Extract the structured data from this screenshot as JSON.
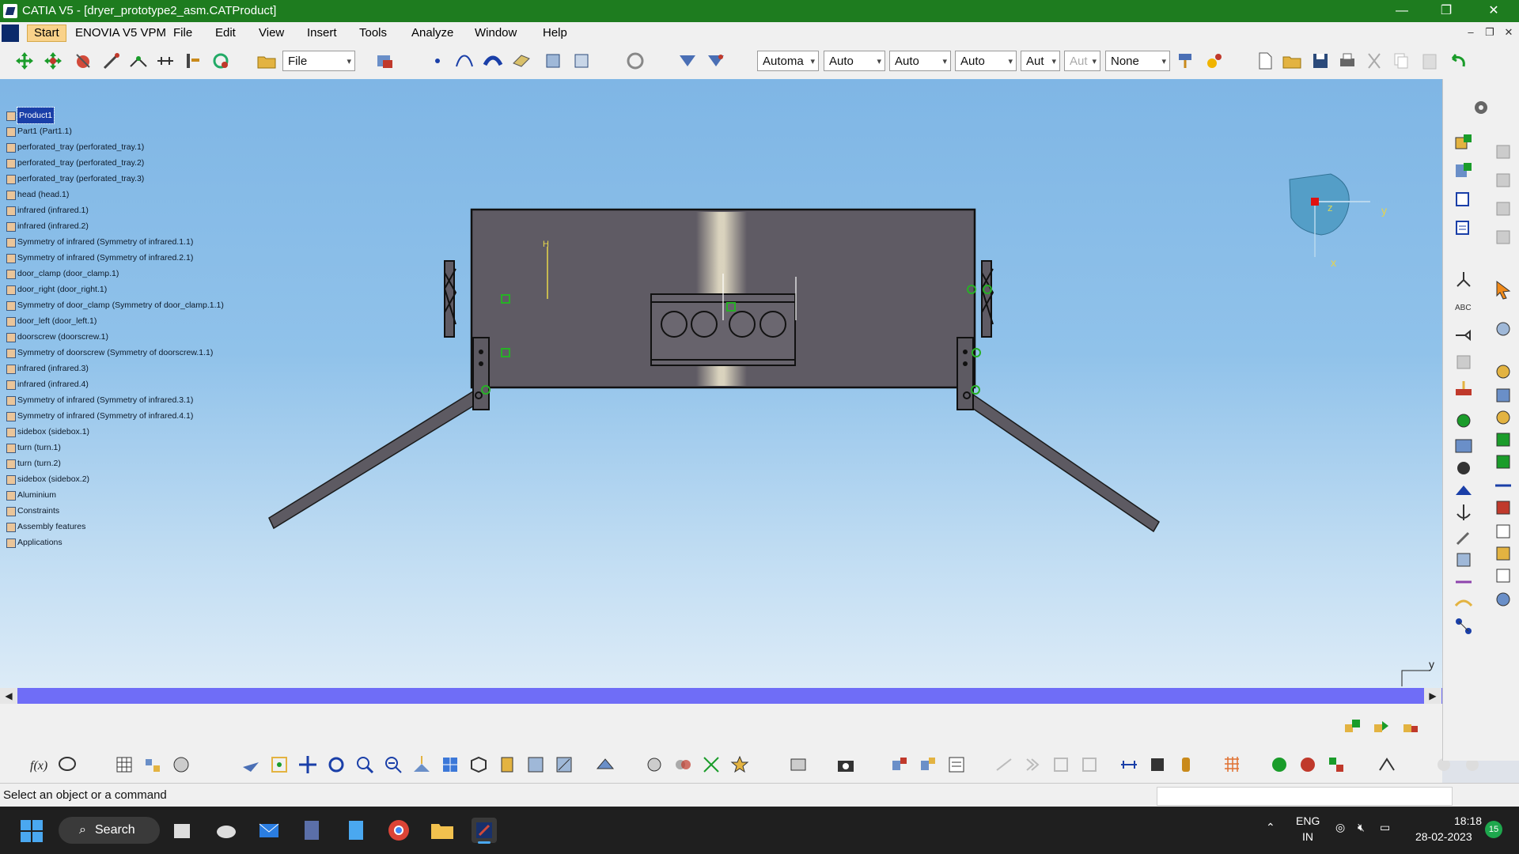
{
  "window": {
    "title": "CATIA V5 - [dryer_prototype2_asm.CATProduct]",
    "minimize": "—",
    "restore": "❐",
    "close": "✕"
  },
  "menu": {
    "items": [
      "Start",
      "ENOVIA V5 VPM",
      "File",
      "Edit",
      "View",
      "Insert",
      "Tools",
      "Analyze",
      "Window",
      "Help"
    ],
    "doc_controls": [
      "–",
      "❐",
      "✕"
    ]
  },
  "toolbar": {
    "file_combo": "File",
    "style_combos": [
      "Automa",
      "Auto",
      "Auto",
      "Auto",
      "Aut",
      "Aut",
      "None"
    ]
  },
  "tree": {
    "nodes": [
      "Product1",
      "Part1 (Part1.1)",
      "perforated_tray (perforated_tray.1)",
      "perforated_tray (perforated_tray.2)",
      "perforated_tray (perforated_tray.3)",
      "head (head.1)",
      "infrared (infrared.1)",
      "infrared (infrared.2)",
      "Symmetry of infrared (Symmetry of infrared.1.1)",
      "Symmetry of infrared (Symmetry of infrared.2.1)",
      "door_clamp (door_clamp.1)",
      "door_right (door_right.1)",
      "Symmetry of door_clamp (Symmetry of door_clamp.1.1)",
      "door_left (door_left.1)",
      "doorscrew (doorscrew.1)",
      "Symmetry of doorscrew (Symmetry of doorscrew.1.1)",
      "infrared (infrared.3)",
      "infrared (infrared.4)",
      "Symmetry of infrared (Symmetry of infrared.3.1)",
      "Symmetry of infrared (Symmetry of infrared.4.1)",
      "sidebox (sidebox.1)",
      "turn (turn.1)",
      "turn (turn.2)",
      "sidebox (sidebox.2)",
      "Aluminium",
      "Constraints",
      "Assembly features",
      "Applications"
    ]
  },
  "compass": {
    "z": "z",
    "y": "y",
    "x": "x"
  },
  "axis_label": "y",
  "scroll": {
    "left": "◀",
    "right": "▶"
  },
  "status": {
    "message": "Select an object or a command"
  },
  "taskbar": {
    "search": "Search",
    "lang1": "ENG",
    "lang2": "IN",
    "time": "18:18",
    "date": "28-02-2023",
    "badge": "15"
  },
  "colors": {
    "titlebar": "#1e7c1f",
    "viewport_top": "#7fb6e5",
    "model": "#5f5b64",
    "scrollbar": "#6f6df7",
    "selection": "#1a3fa8"
  }
}
